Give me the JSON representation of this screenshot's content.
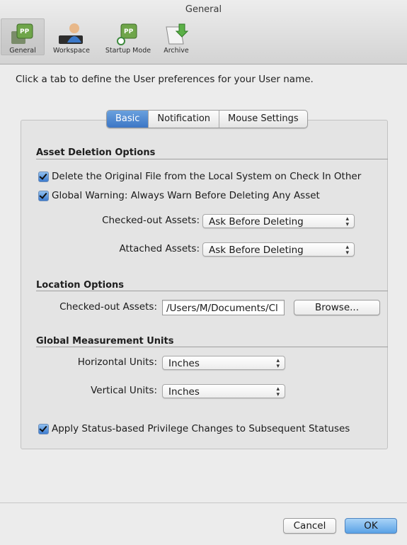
{
  "window": {
    "title": "General"
  },
  "toolbar": {
    "items": [
      {
        "label": "General",
        "icon": "pp-general-icon"
      },
      {
        "label": "Workspace",
        "icon": "workspace-user-icon"
      },
      {
        "label": "Startup Mode",
        "icon": "startup-mode-icon"
      },
      {
        "label": "Archive",
        "icon": "archive-icon"
      }
    ],
    "selected": "General"
  },
  "hint": "Click a tab to define the User preferences for your User name.",
  "tabs": [
    {
      "label": "Basic",
      "selected": true
    },
    {
      "label": "Notification",
      "selected": false
    },
    {
      "label": "Mouse Settings",
      "selected": false
    }
  ],
  "asset_deletion": {
    "heading": "Asset Deletion Options",
    "delete_original": {
      "label": "Delete the Original File from the Local System on Check In Other",
      "checked": true
    },
    "global_warning": {
      "label": "Global Warning: Always Warn Before Deleting Any Asset",
      "checked": true
    },
    "checked_out": {
      "label": "Checked-out Assets:",
      "value": "Ask Before Deleting"
    },
    "attached": {
      "label": "Attached Assets:",
      "value": "Ask Before Deleting"
    }
  },
  "location": {
    "heading": "Location Options",
    "checked_out_label": "Checked-out Assets:",
    "path_value": "/Users/M/Documents/Cl",
    "browse_label": "Browse..."
  },
  "units": {
    "heading": "Global Measurement Units",
    "horizontal": {
      "label": "Horizontal Units:",
      "value": "Inches"
    },
    "vertical": {
      "label": "Vertical Units:",
      "value": "Inches"
    }
  },
  "status_privilege": {
    "label": "Apply Status-based Privilege Changes to Subsequent Statuses",
    "checked": true
  },
  "buttons": {
    "cancel": "Cancel",
    "ok": "OK"
  },
  "colors": {
    "accent": "#3c76c6",
    "window_bg": "#ececec",
    "panel_bg": "#e4e4e4"
  }
}
